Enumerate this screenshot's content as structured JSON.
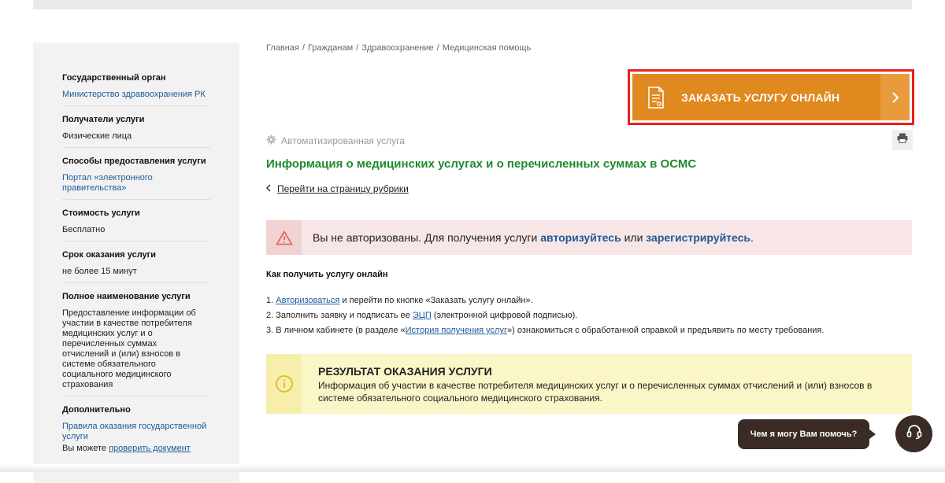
{
  "sidebar": {
    "sections": [
      {
        "title": "Государственный орган",
        "link": "Министерство здравоохранения РК"
      },
      {
        "title": "Получатели услуги",
        "text": "Физические лица"
      },
      {
        "title": "Способы предоставления услуги",
        "link": "Портал «электронного правительства»"
      },
      {
        "title": "Стоимость услуги",
        "text": "Бесплатно"
      },
      {
        "title": "Срок оказания услуги",
        "text": "не более 15 минут"
      },
      {
        "title": "Полное наименование услуги",
        "text": "Предоставление информации об участии в качестве потребителя медицинских услуг и о перечисленных суммах отчислений и (или) взносов в системе обязательного социального медицинского страхования"
      },
      {
        "title": "Дополнительно",
        "link": "Правила оказания государственной услуги",
        "text_prefix": "Вы можете",
        "link2": "проверить документ"
      }
    ]
  },
  "breadcrumb": [
    "Главная",
    "Гражданам",
    "Здравоохранение",
    "Медицинская помощь"
  ],
  "breadcrumb_sep": "/",
  "order_button": {
    "label": "ЗАКАЗАТЬ УСЛУГУ ОНЛАЙН",
    "color": "#e0891f"
  },
  "auto_service": "Автоматизированная услуга",
  "page_title": "Информация о медицинских услугах и о перечисленных суммах в ОСМС",
  "back_link": "Перейти на страницу рубрики",
  "alert": {
    "prefix": "Вы не авторизованы. Для получения услуги",
    "login": "авторизуйтесь",
    "middle": "или",
    "register": "зарегистрируйтесь",
    "suffix": "."
  },
  "howto": {
    "title": "Как получить услугу онлайн",
    "steps": [
      {
        "num": "1.",
        "link": "Авторизоваться",
        "text": "и перейти по кнопке «Заказать услугу онлайн»."
      },
      {
        "num": "2.",
        "pre": "Заполнить заявку и подписать ее",
        "link": "ЭЦП",
        "text": "(электронной цифровой подписью)."
      },
      {
        "num": "3.",
        "pre": "В личном кабинете (в разделе «",
        "link": "История получения услуг",
        "text": "») ознакомиться с обработанной справкой и предъявить по месту требования."
      }
    ]
  },
  "result": {
    "title": "РЕЗУЛЬТАТ ОКАЗАНИЯ УСЛУГИ",
    "text": "Информация об участии в качестве потребителя медицинских услуг и о перечисленных суммах отчислений и (или) взносов в системе обязательного социального медицинского страхования."
  },
  "help": {
    "bubble": "Чем я могу Вам помочь?"
  },
  "colors": {
    "accent_green": "#1f8a2e",
    "link_blue": "#1d5a9a",
    "highlight_red": "#e8201b"
  }
}
